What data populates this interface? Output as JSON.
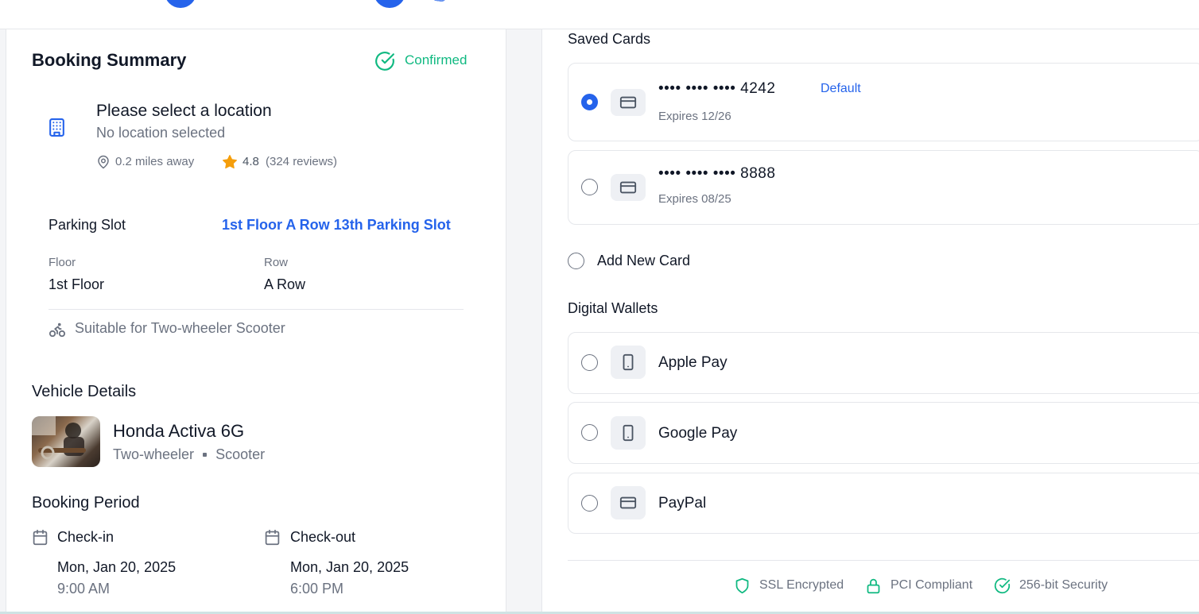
{
  "booking": {
    "title": "Booking Summary",
    "status": "Confirmed",
    "location": {
      "name": "Please select a location",
      "subtitle": "No location selected",
      "distance": "0.2 miles away",
      "rating": "4.8",
      "reviews": "(324 reviews)"
    },
    "slot": {
      "label": "Parking Slot",
      "value": "1st Floor A Row 13th Parking Slot",
      "floor_label": "Floor",
      "floor_value": "1st Floor",
      "row_label": "Row",
      "row_value": "A Row",
      "suitable": "Suitable for Two-wheeler Scooter"
    },
    "vehicle": {
      "section": "Vehicle Details",
      "name": "Honda Activa 6G",
      "type": "Two-wheeler",
      "subtype": "Scooter"
    },
    "period": {
      "section": "Booking Period",
      "checkin_label": "Check-in",
      "checkin_date": "Mon, Jan 20, 2025",
      "checkin_time": "9:00 AM",
      "checkout_label": "Check-out",
      "checkout_date": "Mon, Jan 20, 2025",
      "checkout_time": "6:00 PM"
    }
  },
  "payment": {
    "saved_title": "Saved Cards",
    "cards": [
      {
        "number": "•••• •••• •••• 4242",
        "expires": "Expires 12/26",
        "badge": "Default",
        "selected": true,
        "icon": "credit-card-icon"
      },
      {
        "number": "•••• •••• •••• 8888",
        "expires": "Expires 08/25",
        "selected": false,
        "icon": "credit-card-icon"
      }
    ],
    "add_new": "Add New Card",
    "wallets_title": "Digital Wallets",
    "wallets": [
      {
        "label": "Apple Pay",
        "icon": "smartphone-icon"
      },
      {
        "label": "Google Pay",
        "icon": "smartphone-icon"
      },
      {
        "label": "PayPal",
        "icon": "credit-card-icon"
      }
    ],
    "security": [
      "SSL Encrypted",
      "PCI Compliant",
      "256-bit Security"
    ]
  },
  "colors": {
    "accent": "#2563eb",
    "success": "#10b981",
    "star": "#f59e0b"
  }
}
